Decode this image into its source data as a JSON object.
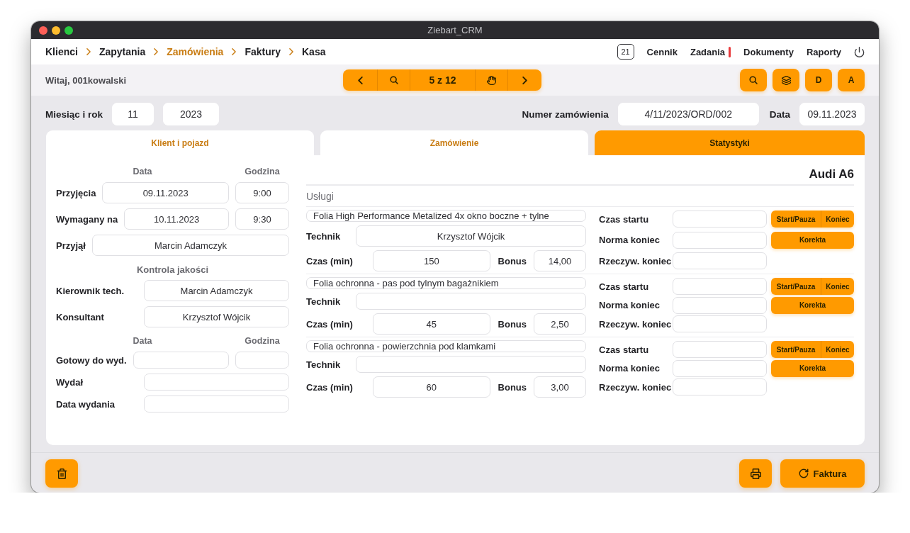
{
  "window": {
    "title": "Ziebart_CRM"
  },
  "breadcrumb": [
    {
      "label": "Klienci",
      "selected": false
    },
    {
      "label": "Zapytania",
      "selected": false
    },
    {
      "label": "Zamówienia",
      "selected": true
    },
    {
      "label": "Faktury",
      "selected": false
    },
    {
      "label": "Kasa",
      "selected": false
    }
  ],
  "nav": {
    "badge": "21",
    "links": [
      {
        "label": "Cennik",
        "alert": false
      },
      {
        "label": "Zadania",
        "alert": true
      },
      {
        "label": "Dokumenty",
        "alert": false
      },
      {
        "label": "Raporty",
        "alert": false
      }
    ]
  },
  "toolbar": {
    "greeting": "Witaj, 001kowalski",
    "pager": "5 z 12",
    "letter_buttons": [
      "D",
      "A"
    ]
  },
  "order": {
    "period_label": "Miesiąc i rok",
    "month": "11",
    "year": "2023",
    "number_label": "Numer zamówienia",
    "number": "4/11/2023/ORD/002",
    "date_label": "Data",
    "date": "09.11.2023"
  },
  "tabs": [
    {
      "label": "Klient i pojazd",
      "selected": false
    },
    {
      "label": "Zamówienie",
      "selected": false
    },
    {
      "label": "Statystyki",
      "selected": true
    }
  ],
  "reception": {
    "columns": [
      "Data",
      "Godzina"
    ],
    "rows": [
      {
        "label": "Przyjęcia",
        "date": "09.11.2023",
        "time": "9:00"
      },
      {
        "label": "Wymagany na",
        "date": "10.11.2023",
        "time": "9:30"
      }
    ],
    "received_by": {
      "label": "Przyjął",
      "value": "Marcin Adamczyk"
    }
  },
  "quality_control": {
    "title": "Kontrola jakości",
    "rows": [
      {
        "label": "Kierownik tech.",
        "value": "Marcin Adamczyk"
      },
      {
        "label": "Konsultant",
        "value": "Krzysztof Wójcik"
      }
    ]
  },
  "release": {
    "columns": [
      "Data",
      "Godzina"
    ],
    "ready": {
      "label": "Gotowy do wyd."
    },
    "rows": [
      {
        "label": "Wydał"
      },
      {
        "label": "Data wydania"
      }
    ]
  },
  "vehicle": {
    "name": "Audi A6"
  },
  "services": {
    "title": "Usługi",
    "items": [
      {
        "name": "Folia High Performance Metalized 4x okno boczne + tylne",
        "technician_label": "Technik",
        "technician": "Krzysztof Wójcik",
        "time_label": "Czas (min)",
        "time": "150",
        "bonus_label": "Bonus",
        "bonus": "14,00",
        "start_label": "Czas startu",
        "start_pause": "Start/Pauza",
        "end": "Koniec",
        "norm_end_label": "Norma koniec",
        "correction": "Korekta",
        "actual_end_label": "Rzeczyw. koniec"
      },
      {
        "name": "Folia ochronna - pas pod tylnym bagażnikiem",
        "technician_label": "Technik",
        "time_label": "Czas (min)",
        "time": "45",
        "bonus_label": "Bonus",
        "bonus": "2,50",
        "start_label": "Czas startu",
        "start_pause": "Start/Pauza",
        "end": "Koniec",
        "norm_end_label": "Norma koniec",
        "correction": "Korekta",
        "actual_end_label": "Rzeczyw. koniec"
      },
      {
        "name": "Folia ochronna - powierzchnia pod klamkami",
        "technician_label": "Technik",
        "time_label": "Czas (min)",
        "time": "60",
        "bonus_label": "Bonus",
        "bonus": "3,00",
        "start_label": "Czas startu",
        "start_pause": "Start/Pauza",
        "end": "Koniec",
        "norm_end_label": "Norma koniec",
        "correction": "Korekta",
        "actual_end_label": "Rzeczyw. koniec"
      }
    ]
  },
  "footer": {
    "invoice_button": "Faktura"
  }
}
